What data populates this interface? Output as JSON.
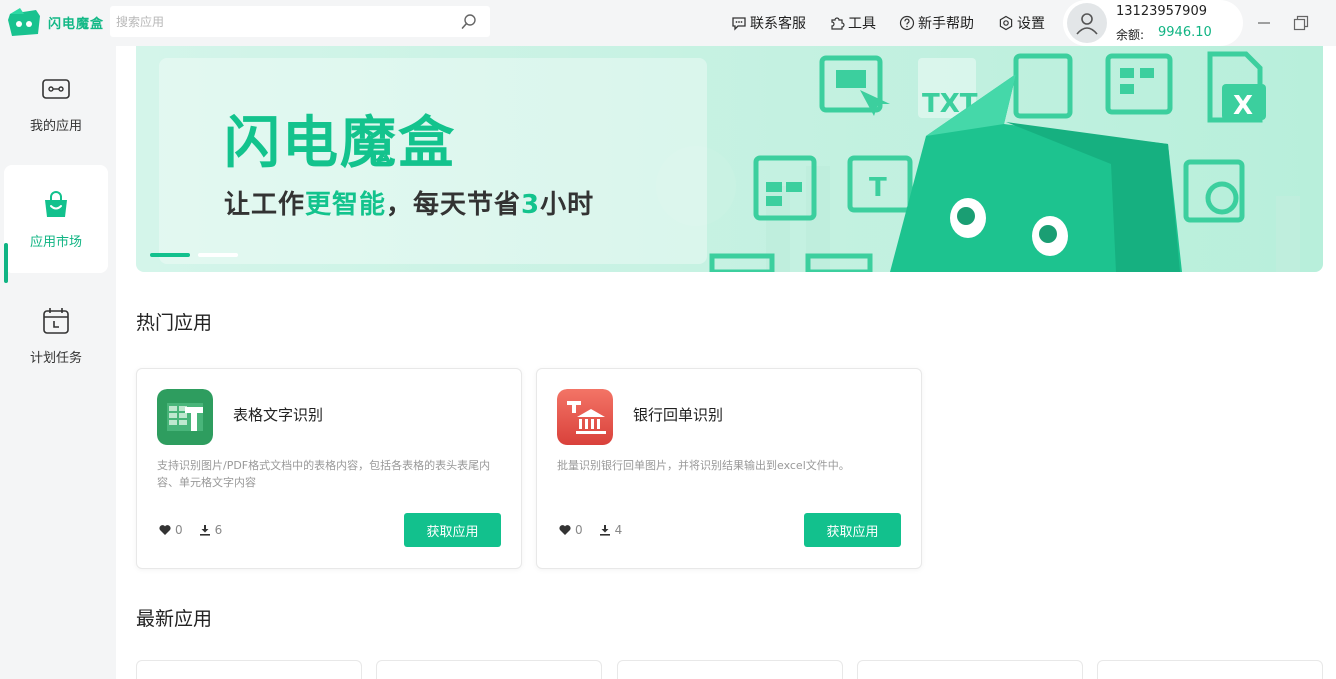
{
  "app": {
    "logo_text": "闪电魔盒"
  },
  "search": {
    "placeholder": "搜索应用"
  },
  "topnav": {
    "contact": "联系客服",
    "tools": "工具",
    "help": "新手帮助",
    "settings": "设置"
  },
  "user": {
    "phone": "13123957909",
    "balance_label": "余额:",
    "balance": "9946.10"
  },
  "sidebar": {
    "items": [
      {
        "label": "我的应用"
      },
      {
        "label": "应用市场"
      },
      {
        "label": "计划任务"
      }
    ]
  },
  "banner": {
    "title": "闪电魔盒",
    "sub_a": "让工作",
    "sub_hl1": "更智能",
    "sub_b": "，每天节省",
    "sub_hl2": "3",
    "sub_c": "小时",
    "icon_txt": "TXT",
    "icon_t": "T",
    "icon_x": "X"
  },
  "sections": {
    "hot": "热门应用",
    "new": "最新应用"
  },
  "apps": [
    {
      "name": "表格文字识别",
      "desc": "支持识别图片/PDF格式文档中的表格内容，包括各表格的表头表尾内容、单元格文字内容",
      "likes": "0",
      "downloads": "6",
      "button": "获取应用",
      "icon": "table-ocr-icon",
      "color": "#2e9d5f"
    },
    {
      "name": "银行回单识别",
      "desc": "批量识别银行回单图片，并将识别结果输出到excel文件中。",
      "likes": "0",
      "downloads": "4",
      "button": "获取应用",
      "icon": "bank-receipt-icon",
      "color": "#e04b45"
    }
  ],
  "colors": {
    "accent": "#12c18d",
    "sidebar_bg": "#f4f5f6"
  }
}
